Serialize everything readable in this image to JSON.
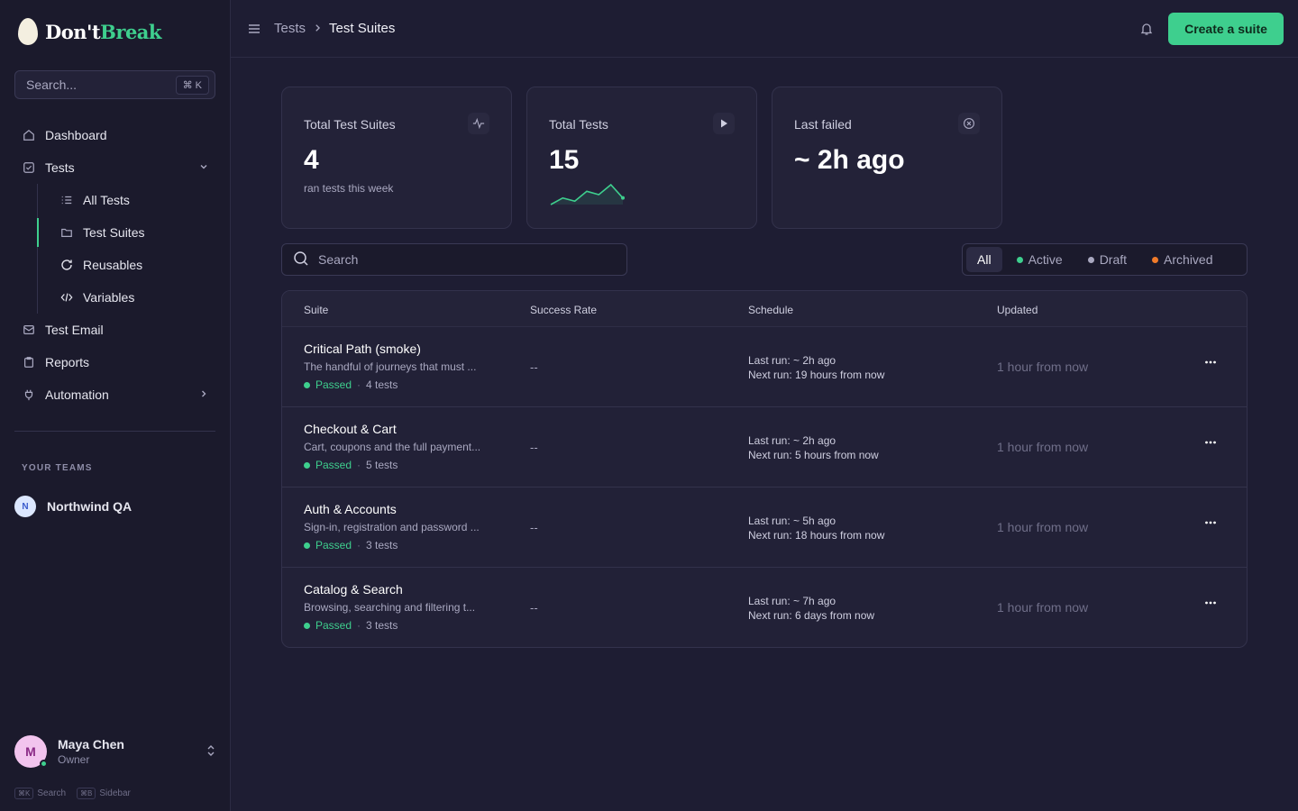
{
  "brand": {
    "part1": "Don't",
    "part2": "Break"
  },
  "sidebar": {
    "search_placeholder": "Search...",
    "search_shortcut": "⌘ K",
    "nav": {
      "dashboard": "Dashboard",
      "tests": "Tests",
      "all_tests": "All Tests",
      "test_suites": "Test Suites",
      "reusables": "Reusables",
      "variables": "Variables",
      "test_email": "Test Email",
      "reports": "Reports",
      "automation": "Automation"
    },
    "teams_label": "YOUR TEAMS",
    "team": {
      "initial": "N",
      "name": "Northwind QA"
    },
    "user": {
      "initial": "M",
      "name": "Maya Chen",
      "role": "Owner"
    },
    "hints": {
      "search_key": "⌘K",
      "search_label": "Search",
      "sidebar_key": "⌘B",
      "sidebar_label": "Sidebar"
    }
  },
  "header": {
    "breadcrumb_parent": "Tests",
    "breadcrumb_current": "Test Suites",
    "create_button": "Create a suite"
  },
  "stats": {
    "suites": {
      "label": "Total Test Suites",
      "value": "4",
      "sub": "ran tests this week",
      "icon": "activity-icon"
    },
    "tests": {
      "label": "Total Tests",
      "value": "15",
      "icon": "play-icon",
      "sparkline": [
        2,
        4,
        3,
        6,
        5,
        8,
        4
      ]
    },
    "failed": {
      "label": "Last failed",
      "value": "~ 2h ago",
      "icon": "x-circle-icon"
    }
  },
  "search": {
    "placeholder": "Search"
  },
  "filters": [
    {
      "label": "All",
      "selected": true,
      "color": ""
    },
    {
      "label": "Active",
      "selected": false,
      "color": "#3ecf8e"
    },
    {
      "label": "Draft",
      "selected": false,
      "color": "#a9a8c0"
    },
    {
      "label": "Archived",
      "selected": false,
      "color": "#f07b2a"
    }
  ],
  "table": {
    "headers": {
      "suite": "Suite",
      "rate": "Success Rate",
      "schedule": "Schedule",
      "updated": "Updated"
    },
    "rows": [
      {
        "name": "Critical Path (smoke)",
        "desc": "The handful of journeys that must ...",
        "status": "Passed",
        "count": "4 tests",
        "rate": "--",
        "last_run": "Last run: ~ 2h ago",
        "next_run": "Next run: 19 hours from now",
        "updated": "1 hour from now"
      },
      {
        "name": "Checkout & Cart",
        "desc": "Cart, coupons and the full payment...",
        "status": "Passed",
        "count": "5 tests",
        "rate": "--",
        "last_run": "Last run: ~ 2h ago",
        "next_run": "Next run: 5 hours from now",
        "updated": "1 hour from now"
      },
      {
        "name": "Auth & Accounts",
        "desc": "Sign-in, registration and password ...",
        "status": "Passed",
        "count": "3 tests",
        "rate": "--",
        "last_run": "Last run: ~ 5h ago",
        "next_run": "Next run: 18 hours from now",
        "updated": "1 hour from now"
      },
      {
        "name": "Catalog & Search",
        "desc": "Browsing, searching and filtering t...",
        "status": "Passed",
        "count": "3 tests",
        "rate": "--",
        "last_run": "Last run: ~ 7h ago",
        "next_run": "Next run: 6 days from now",
        "updated": "1 hour from now"
      }
    ]
  },
  "colors": {
    "accent": "#3ecf8e",
    "background": "#1e1d33",
    "sidebar": "#1b1a2c"
  }
}
